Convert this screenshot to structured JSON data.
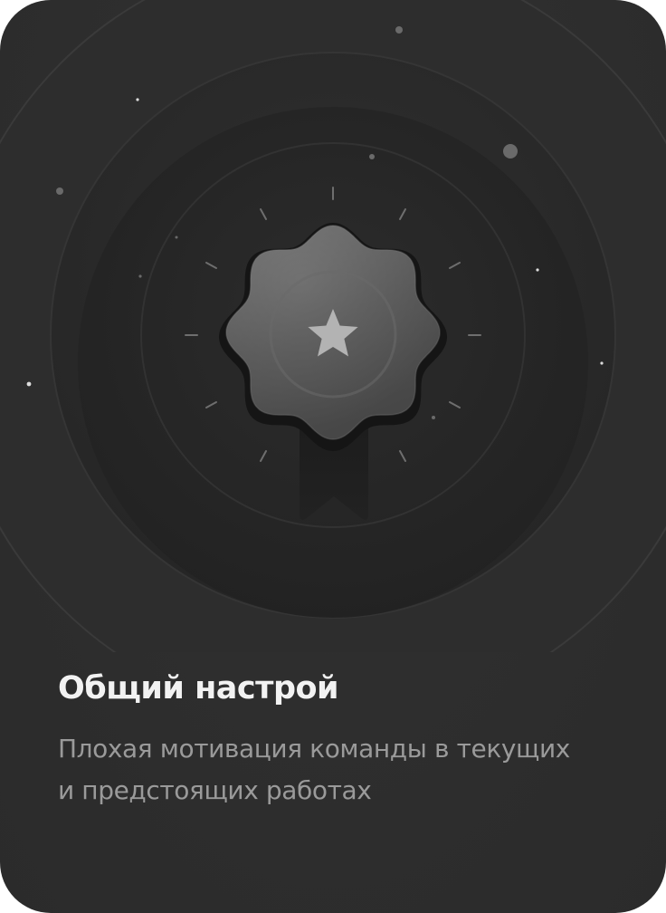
{
  "card": {
    "title": "Общий настрой",
    "description_lines": [
      "Плохая мотивация команды в текущих",
      "и предстоящих работах"
    ],
    "illustration_icon": "award-badge-star-icon"
  },
  "colors": {
    "card_background": "#2e2e2e",
    "title": "#f2f2f2",
    "description": "#9a9a9a",
    "badge": "#5a5a5a",
    "star": "#b3b3b3"
  }
}
